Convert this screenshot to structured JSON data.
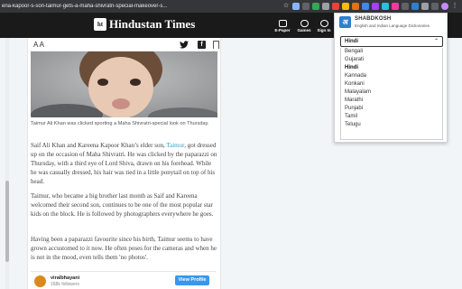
{
  "browser": {
    "url": "ena-kapoor-s-son-taimur-gets-a-maha-shivratri-special-makeover-s..."
  },
  "site": {
    "logo_text": "Hindustan Times",
    "logo_mark": "ht",
    "nav": [
      {
        "label": "E-Paper",
        "icon": "newspaper-icon"
      },
      {
        "label": "Games",
        "icon": "gamepad-icon"
      },
      {
        "label": "Sign In",
        "icon": "user-icon"
      }
    ]
  },
  "article": {
    "font_size_label": "A A",
    "caption": "Taimur Ali Khan was clicked sporting a Maha Shivratri-special look on Thursday.",
    "para1_before": "Saif Ali Khan and Kareena Kapoor Khan’s elder son, ",
    "para1_link": "Taimur",
    "para1_after": ", got dressed up on the occasion of Maha Shivratri. He was clicked by the paparazzi on Thursday, with a third eye of Lord Shiva, drawn on his forehead. While he was casually dressed, his hair was tied in a little ponytail on top of his head.",
    "para2": "Taimur, who became a big brother last month as Saif and Kareena welcomed their second son, continues to be one of the most popular star kids on the block. He is followed by photographers everywhere he goes.",
    "para3": "Having been a paparazzi favourite since his birth, Taimur seems to have grown accustomed to it now. He often poses for the cameras and when he is not in the mood, even tells them 'no photos'.",
    "profile": {
      "handle": "viralbhayani",
      "followers": "168k followers",
      "button": "View Profile"
    }
  },
  "popup": {
    "title": "SHABDKOSH",
    "subtitle": "English and Indian Language Dictionaries",
    "logo_letter": "अ",
    "selected": "Hindi",
    "chevron": "⌃",
    "options": [
      "Bengali",
      "Gujarati",
      "Hindi",
      "Kannada",
      "Konkani",
      "Malayalam",
      "Marathi",
      "Punjabi",
      "Tamil",
      "Telugu"
    ]
  }
}
